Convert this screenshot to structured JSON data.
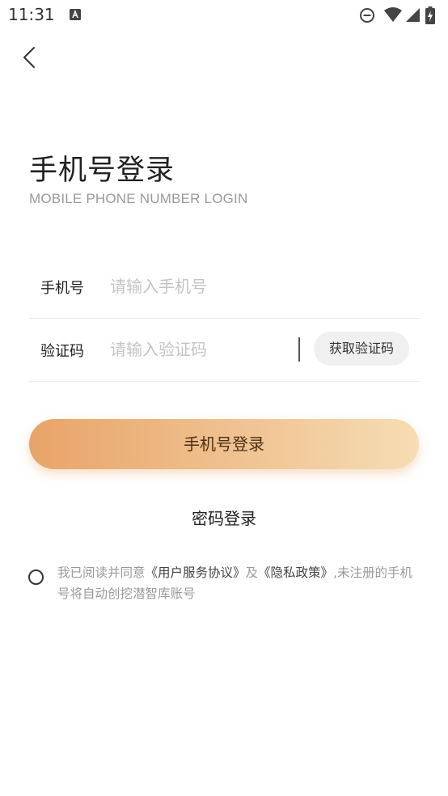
{
  "status_bar": {
    "time": "11:31",
    "icons": [
      "a-notification-icon",
      "do-not-disturb-icon",
      "wifi-icon",
      "cellular-signal-icon",
      "battery-charging-icon"
    ]
  },
  "header": {
    "back_icon": "back-chevron-icon"
  },
  "title": "手机号登录",
  "subtitle": "MOBILE PHONE NUMBER LOGIN",
  "form": {
    "phone": {
      "label": "手机号",
      "placeholder": "请输入手机号",
      "value": ""
    },
    "code": {
      "label": "验证码",
      "placeholder": "请输入验证码",
      "value": "",
      "get_code_label": "获取验证码"
    }
  },
  "login_button_label": "手机号登录",
  "password_login_label": "密码登录",
  "agreement": {
    "prefix": "我已阅读并同意",
    "terms_link": "《用户服务协议》",
    "and": "及",
    "privacy_link": "《隐私政策》",
    "suffix": ",未注册的手机号将自动创挖潜智库账号",
    "checked": false
  },
  "colors": {
    "button_gradient_start": "#e8a468",
    "button_gradient_end": "#f6ddb4",
    "placeholder": "#c4c4c4",
    "muted_text": "#9a9a9a"
  }
}
